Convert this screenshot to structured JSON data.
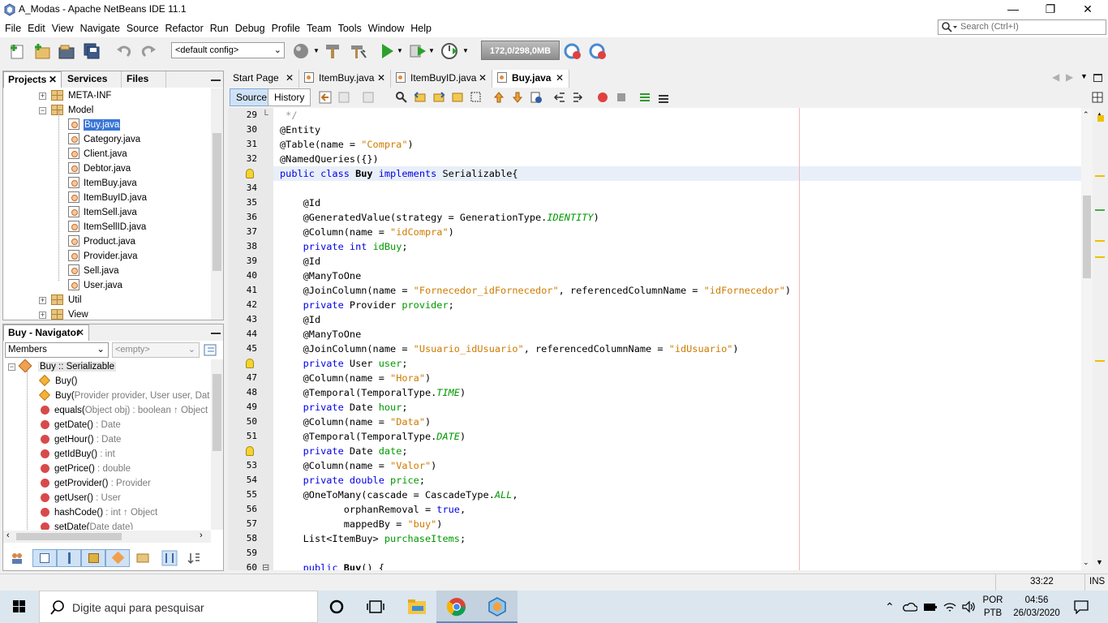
{
  "window": {
    "title": "A_Modas - Apache NetBeans IDE 11.1",
    "min": "—",
    "max": "❐",
    "close": "✕"
  },
  "menu": [
    "File",
    "Edit",
    "View",
    "Navigate",
    "Source",
    "Refactor",
    "Run",
    "Debug",
    "Profile",
    "Team",
    "Tools",
    "Window",
    "Help"
  ],
  "search": {
    "placeholder": "Search (Ctrl+I)"
  },
  "toolbar": {
    "config": "<default config>",
    "memory": "172,0/298,0MB"
  },
  "projects_panel": {
    "tabs": [
      "Projects",
      "Services",
      "Files"
    ],
    "tree": [
      {
        "label": "META-INF",
        "type": "package"
      },
      {
        "label": "Model",
        "type": "package",
        "expanded": true
      },
      {
        "label": "Buy.java",
        "type": "file",
        "selected": true
      },
      {
        "label": "Category.java",
        "type": "file"
      },
      {
        "label": "Client.java",
        "type": "file"
      },
      {
        "label": "Debtor.java",
        "type": "file"
      },
      {
        "label": "ItemBuy.java",
        "type": "file"
      },
      {
        "label": "ItemBuyID.java",
        "type": "file"
      },
      {
        "label": "ItemSell.java",
        "type": "file"
      },
      {
        "label": "ItemSellID.java",
        "type": "file"
      },
      {
        "label": "Product.java",
        "type": "file"
      },
      {
        "label": "Provider.java",
        "type": "file"
      },
      {
        "label": "Sell.java",
        "type": "file"
      },
      {
        "label": "User.java",
        "type": "file"
      },
      {
        "label": "Util",
        "type": "package"
      },
      {
        "label": "View",
        "type": "package"
      }
    ]
  },
  "navigator": {
    "title": "Buy - Navigator",
    "members_label": "Members",
    "filter_placeholder": "<empty>",
    "root": "Buy :: Serializable",
    "items": [
      {
        "name": "Buy()",
        "type": "",
        "kind": "ctor"
      },
      {
        "name": "Buy(",
        "type": "Provider provider, User user, Date",
        "kind": "ctor",
        "plain_params": true
      },
      {
        "name": "equals(",
        "type": "Object obj) : boolean ↑ Object",
        "kind": "method",
        "equals": true
      },
      {
        "name": "getDate()",
        "type": " : Date",
        "kind": "method"
      },
      {
        "name": "getHour()",
        "type": " : Date",
        "kind": "method"
      },
      {
        "name": "getIdBuy()",
        "type": " : int",
        "kind": "method"
      },
      {
        "name": "getPrice()",
        "type": " : double",
        "kind": "method"
      },
      {
        "name": "getProvider()",
        "type": " : Provider",
        "kind": "method"
      },
      {
        "name": "getUser()",
        "type": " : User",
        "kind": "method"
      },
      {
        "name": "hashCode()",
        "type": " : int ↑ Object",
        "kind": "method",
        "hash": true
      },
      {
        "name": "setDate(",
        "type": "Date date)",
        "kind": "method"
      }
    ]
  },
  "editor": {
    "tabs": [
      "Start Page",
      "ItemBuy.java",
      "ItemBuyID.java",
      "Buy.java"
    ],
    "active_tab": "Buy.java",
    "views": [
      "Source",
      "History"
    ],
    "lines": [
      {
        "n": "29",
        "html": "<span class='cm'> */</span>"
      },
      {
        "n": "30",
        "html": "@Entity"
      },
      {
        "n": "31",
        "html": "@Table(name = <span class='st'>\"Compra\"</span>)"
      },
      {
        "n": "32",
        "html": "@NamedQueries({})"
      },
      {
        "n": "",
        "html": "<span class='kw'>public class</span> <b>Buy</b> <span class='kw'>implements</span> Serializable{",
        "hl": true,
        "bulb": true
      },
      {
        "n": "34",
        "html": ""
      },
      {
        "n": "35",
        "html": "    @Id"
      },
      {
        "n": "36",
        "html": "    @GeneratedValue(strategy = GenerationType.<span class='it'>IDENTITY</span>)"
      },
      {
        "n": "37",
        "html": "    @Column(name = <span class='st'>\"idCompra\"</span>)"
      },
      {
        "n": "38",
        "html": "    <span class='kw'>private int</span> <span class='fld'>idBuy</span>;"
      },
      {
        "n": "39",
        "html": "    @Id"
      },
      {
        "n": "40",
        "html": "    @ManyToOne"
      },
      {
        "n": "41",
        "html": "    @JoinColumn(name = <span class='st'>\"Fornecedor_idFornecedor\"</span>, referencedColumnName = <span class='st'>\"idFornecedor\"</span>)"
      },
      {
        "n": "42",
        "html": "    <span class='kw'>private</span> Provider <span class='fld'>provider</span>;"
      },
      {
        "n": "43",
        "html": "    @Id"
      },
      {
        "n": "44",
        "html": "    @ManyToOne"
      },
      {
        "n": "45",
        "html": "    @JoinColumn(name = <span class='st'>\"Usuario_idUsuario\"</span>, referencedColumnName = <span class='st'>\"idUsuario\"</span>)"
      },
      {
        "n": "",
        "html": "    <span class='kw'>private</span> User <span class='fld'>user</span>;",
        "bulb": true
      },
      {
        "n": "47",
        "html": "    @Column(name = <span class='st'>\"Hora\"</span>)"
      },
      {
        "n": "48",
        "html": "    @Temporal(TemporalType.<span class='it'>TIME</span>)"
      },
      {
        "n": "49",
        "html": "    <span class='kw'>private</span> Date <span class='fld'>hour</span>;"
      },
      {
        "n": "50",
        "html": "    @Column(name = <span class='st'>\"Data\"</span>)"
      },
      {
        "n": "51",
        "html": "    @Temporal(TemporalType.<span class='it'>DATE</span>)"
      },
      {
        "n": "",
        "html": "    <span class='kw'>private</span> Date <span class='fld'>date</span>;",
        "bulb": true
      },
      {
        "n": "53",
        "html": "    @Column(name = <span class='st'>\"Valor\"</span>)"
      },
      {
        "n": "54",
        "html": "    <span class='kw'>private double</span> <span class='fld'>price</span>;"
      },
      {
        "n": "55",
        "html": "    @OneToMany(cascade = CascadeType.<span class='it'>ALL</span>,"
      },
      {
        "n": "56",
        "html": "           orphanRemoval = <span class='kw'>true</span>,"
      },
      {
        "n": "57",
        "html": "           mappedBy = <span class='st'>\"buy\"</span>)"
      },
      {
        "n": "58",
        "html": "    List&lt;ItemBuy&gt; <span class='fld'>purchaseItems</span>;"
      },
      {
        "n": "59",
        "html": ""
      },
      {
        "n": "60",
        "html": "    <span class='kw'>public</span> <b>Buy</b>() {"
      }
    ]
  },
  "status": {
    "position": "33:22",
    "mode": "INS"
  },
  "taskbar": {
    "search_placeholder": "Digite aqui para pesquisar",
    "lang1": "POR",
    "lang2": "PTB",
    "time": "04:56",
    "date": "26/03/2020"
  }
}
